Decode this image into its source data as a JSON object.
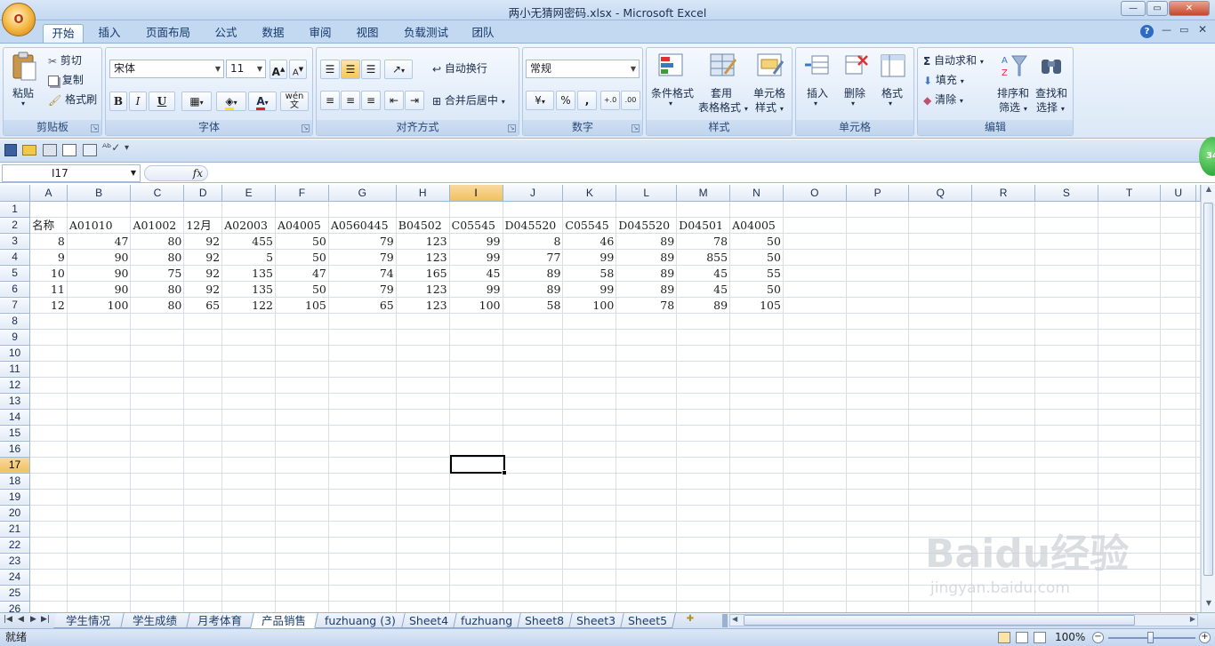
{
  "window": {
    "title": "两小无猜网密码.xlsx - Microsoft Excel",
    "office_button_label": "O",
    "minimize": "—",
    "restore": "▭",
    "close": "✕"
  },
  "ribbon_tabs": [
    "开始",
    "插入",
    "页面布局",
    "公式",
    "数据",
    "审阅",
    "视图",
    "负载测试",
    "团队"
  ],
  "ribbon": {
    "clipboard": {
      "label": "剪贴板",
      "paste": "粘贴",
      "cut": "剪切",
      "copy": "复制",
      "format_painter": "格式刷"
    },
    "font": {
      "label": "字体",
      "font_name": "宋体",
      "font_size": "11",
      "grow": "A",
      "shrink": "A",
      "bold": "B",
      "italic": "I",
      "underline": "U",
      "wen": "wén",
      "phonetic": "文"
    },
    "alignment": {
      "label": "对齐方式",
      "wrap_text": "自动换行",
      "merge_center": "合并后居中"
    },
    "number": {
      "label": "数字",
      "format": "常规",
      "percent": "%",
      "comma": ",",
      "inc_decimal": "+.0",
      "dec_decimal": ".00"
    },
    "styles": {
      "label": "样式",
      "conditional": "条件格式",
      "table_format_1": "套用",
      "table_format_2": "表格格式",
      "cell_styles_1": "单元格",
      "cell_styles_2": "样式"
    },
    "cells": {
      "label": "单元格",
      "insert": "插入",
      "delete": "删除",
      "format": "格式"
    },
    "editing": {
      "label": "编辑",
      "autosum": "自动求和",
      "fill": "填充",
      "clear": "清除",
      "sort_1": "排序和",
      "sort_2": "筛选",
      "find_1": "查找和",
      "find_2": "选择"
    }
  },
  "formula_bar": {
    "name_box": "I17",
    "fx": "fx",
    "formula": ""
  },
  "grid": {
    "columns": [
      "A",
      "B",
      "C",
      "D",
      "E",
      "F",
      "G",
      "H",
      "I",
      "J",
      "K",
      "L",
      "M",
      "N",
      "O",
      "P",
      "Q",
      "R",
      "S",
      "T",
      "U"
    ],
    "selected_column": "I",
    "selected_row": 17,
    "row_count": 26,
    "rows": {
      "2": [
        "名称",
        "A01010",
        "A01002",
        "12月",
        "A02003",
        "A04005",
        "A0560445",
        "B04502",
        "C05545",
        "D045520",
        "C05545",
        "D045520",
        "D04501",
        "A04005"
      ],
      "3": [
        "8",
        "47",
        "80",
        "92",
        "455",
        "50",
        "79",
        "123",
        "99",
        "8",
        "46",
        "89",
        "78",
        "50"
      ],
      "4": [
        "9",
        "90",
        "80",
        "92",
        "5",
        "50",
        "79",
        "123",
        "99",
        "77",
        "99",
        "89",
        "855",
        "50"
      ],
      "5": [
        "10",
        "90",
        "75",
        "92",
        "135",
        "47",
        "74",
        "165",
        "45",
        "89",
        "58",
        "89",
        "45",
        "55"
      ],
      "6": [
        "11",
        "90",
        "80",
        "92",
        "135",
        "50",
        "79",
        "123",
        "99",
        "89",
        "99",
        "89",
        "45",
        "50"
      ],
      "7": [
        "12",
        "100",
        "80",
        "65",
        "122",
        "105",
        "65",
        "123",
        "100",
        "58",
        "100",
        "78",
        "89",
        "105"
      ]
    }
  },
  "sheet_tabs": [
    "学生情况",
    "学生成绩",
    "月考体育",
    "产品销售",
    "fuzhuang (3)",
    "Sheet4",
    "fuzhuang",
    "Sheet8",
    "Sheet3",
    "Sheet5"
  ],
  "active_sheet": "产品销售",
  "status_bar": {
    "ready": "就绪",
    "zoom": "100%"
  },
  "badge": "34",
  "watermark": {
    "line1": "Baidu经验",
    "line2": "jingyan.baidu.com"
  }
}
